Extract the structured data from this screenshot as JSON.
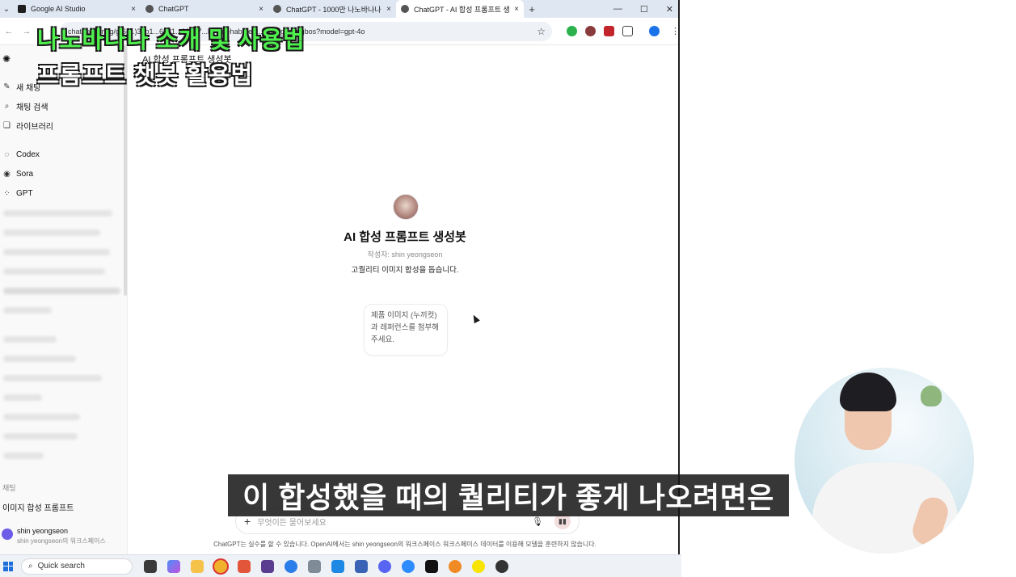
{
  "overlay": {
    "title_line1": "나노바나나 소개 및 사용법",
    "title_line2": "프롬프트 챗봇 활용법",
    "subtitle": "이 합성했을 때의 퀄리티가 좋게 나오려면은"
  },
  "browser": {
    "tabs": [
      {
        "label": "Google AI Studio",
        "close": "×",
        "color": "#1f1f1f"
      },
      {
        "label": "ChatGPT",
        "close": "×",
        "color": "#555555"
      },
      {
        "label": "ChatGPT - 1000만 나노바나나",
        "close": "×",
        "color": "#555555"
      },
      {
        "label": "ChatGPT - AI 합성 프롬프트 생",
        "close": "×",
        "color": "#555555"
      }
    ],
    "new_tab": "+",
    "url": "chatgpt.com/g/g-6(...)35b1...6881...33527...b7...ai-hab...eo...-saengseongbos?model=gpt-4o",
    "star_icon": "star-icon"
  },
  "sidebar": {
    "items": [
      {
        "label": "새 채팅",
        "icon": "new-chat-icon"
      },
      {
        "label": "채팅 검색",
        "icon": "search-icon"
      },
      {
        "label": "라이브러리",
        "icon": "library-icon"
      },
      {
        "label": "Codex",
        "icon": "codex-icon"
      },
      {
        "label": "Sora",
        "icon": "sora-icon"
      },
      {
        "label": "GPT",
        "icon": "gpt-grid-icon"
      }
    ],
    "section_label": "채팅",
    "chat_item": "이미지 합성 프롬프트",
    "user": {
      "name": "shin yeongseon",
      "workspace": "shin yeongseon의 워크스페이스"
    }
  },
  "main": {
    "header_title": "AI 합성 프롬프트 생성봇",
    "gpt_name": "AI 합성 프롬프트 생성봇",
    "author": "작성자: shin yeongseon",
    "description": "고퀄리티 이미지 합성을 돕습니다.",
    "starter": "제품 이미지 (누끼컷)과 레퍼런스를 첨부해주세요.",
    "composer_placeholder": "무엇이든 물어보세요",
    "disclaimer": "ChatGPT는 실수를 할 수 있습니다. OpenAI에서는 shin yeongseon의 워크스페이스 워크스페이스 데이터를 이용해 모델을 훈련하지 않습니다."
  },
  "taskbar": {
    "search_placeholder": "Quick search"
  }
}
